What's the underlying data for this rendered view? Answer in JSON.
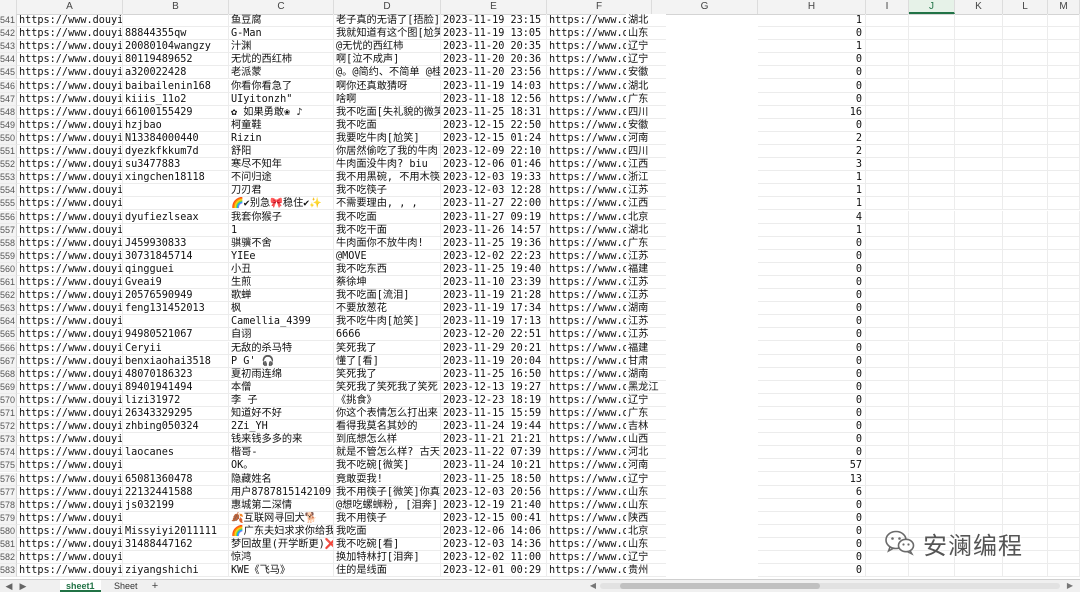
{
  "columns": [
    "",
    "A",
    "B",
    "C",
    "D",
    "E",
    "F",
    "G",
    "H",
    "I",
    "J",
    "K",
    "L",
    "M"
  ],
  "selected_column": "J",
  "rows": [
    [
      "541",
      "https://www.douyin.cc",
      "",
      "鱼豆腐",
      "老子真的无语了[捂脸]",
      "2023-11-19 23:15",
      "https://www.douyin.cc",
      "湖北",
      "1"
    ],
    [
      "542",
      "https://www.douyin.cc",
      "88844355qw",
      "G-Man",
      "我就知道有这个图[尬笑]",
      "2023-11-19 13:05",
      "https://www.douyin.cc",
      "山东",
      "0"
    ],
    [
      "543",
      "https://www.douyin.cc",
      "20080104wangzy",
      "汁渊",
      "@无忧的西红柿",
      "2023-11-20 20:35",
      "https://www.douyin.cc",
      "辽宁",
      "1"
    ],
    [
      "544",
      "https://www.douyin.cc",
      "80119489652",
      "无忧的西红柿",
      "啊[泣不成声]",
      "2023-11-20 20:36",
      "https://www.douyin.cc",
      "辽宁",
      "0"
    ],
    [
      "545",
      "https://www.douyin.cc",
      "a320022428",
      "老派蒙",
      "@。@简约、不简单 @桂@",
      "2023-11-20 23:56",
      "https://www.douyin.cc",
      "安徽",
      "0"
    ],
    [
      "546",
      "https://www.douyin.cc",
      "baibailenin168",
      "你看你看急了",
      "啊你还真敢猜呀",
      "2023-11-19 14:03",
      "https://www.douyin.cc",
      "湖北",
      "0"
    ],
    [
      "547",
      "https://www.douyin.cc",
      "kiiis_11o2",
      "UIyitonzh\"",
      "啥啊",
      "2023-11-18 12:56",
      "https://www.douyin.cc",
      "广东",
      "0"
    ],
    [
      "548",
      "https://www.douyin.cc",
      "66100155429",
      "✿ 如果勇敢❀ ♪",
      "我不吃面[失礼貌的微笑]",
      "2023-11-25 18:31",
      "https://www.douyin.cc",
      "四川",
      "16"
    ],
    [
      "549",
      "https://www.douyin.cc",
      "hzjbao",
      "柯童鞋",
      "我不吃面",
      "2023-12-15 22:50",
      "https://www.douyin.cc",
      "安徽",
      "0"
    ],
    [
      "550",
      "https://www.douyin.cc",
      "N13384000440",
      "Rizin",
      "我要吃牛肉[尬笑]",
      "2023-12-15 01:24",
      "https://www.douyin.cc",
      "河南",
      "2"
    ],
    [
      "551",
      "https://www.douyin.cc",
      "dyezkfkkum7d",
      "舒阳",
      "你居然偷吃了我的牛肉",
      "2023-12-09 22:10",
      "https://www.douyin.cc",
      "四川",
      "2"
    ],
    [
      "552",
      "https://www.douyin.cc",
      "su3477883",
      "寒尽不知年",
      "牛肉面没牛肉? biu",
      "2023-12-06 01:46",
      "https://www.douyin.cc",
      "江西",
      "3"
    ],
    [
      "553",
      "https://www.douyin.cc",
      "xingchen18118",
      "不问归途",
      "我不用黑碗, 不用木筷",
      "2023-12-03 19:33",
      "https://www.douyin.cc",
      "浙江",
      "1"
    ],
    [
      "554",
      "https://www.douyin.cc",
      "",
      "刀刃君",
      "我不吃筷子",
      "2023-12-03 12:28",
      "https://www.douyin.cc",
      "江苏",
      "1"
    ],
    [
      "555",
      "https://www.douyin.cc",
      "",
      "🌈✔别急🎀稳住✔✨",
      "不需要理由, , ,",
      "2023-11-27 22:00",
      "https://www.douyin.cc",
      "江西",
      "1"
    ],
    [
      "556",
      "https://www.douyin.cc",
      "dyufiezlseax",
      "我套你猴子",
      "我不吃面",
      "2023-11-27 09:19",
      "https://www.douyin.cc",
      "北京",
      "4"
    ],
    [
      "557",
      "https://www.douyin.cc",
      "",
      "1",
      "我不吃干面",
      "2023-11-26 14:57",
      "https://www.douyin.cc",
      "湖北",
      "1"
    ],
    [
      "558",
      "https://www.douyin.cc",
      "J459930833",
      "骐骥不舍",
      "牛肉面你不放牛肉!",
      "2023-11-25 19:36",
      "https://www.douyin.cc",
      "广东",
      "0"
    ],
    [
      "559",
      "https://www.douyin.cc",
      "30731845714",
      "YIEe",
      "@MOVE",
      "2023-12-02 22:23",
      "https://www.douyin.cc",
      "江苏",
      "0"
    ],
    [
      "560",
      "https://www.douyin.cc",
      "qingguei",
      "小丑",
      "我不吃东西",
      "2023-11-25 19:40",
      "https://www.douyin.cc",
      "福建",
      "0"
    ],
    [
      "561",
      "https://www.douyin.cc",
      "Gveai9",
      "生煎",
      "蔡徐坤",
      "2023-11-10 23:39",
      "https://www.douyin.cc",
      "江苏",
      "0"
    ],
    [
      "562",
      "https://www.douyin.cc",
      "20576590949",
      "歌蝉",
      "我不吃面[流泪]",
      "2023-11-19 21:28",
      "https://www.douyin.cc",
      "江苏",
      "0"
    ],
    [
      "563",
      "https://www.douyin.cc",
      "feng131452013",
      "枫",
      "不要放葱花",
      "2023-11-19 17:34",
      "https://www.douyin.cc",
      "湖南",
      "0"
    ],
    [
      "564",
      "https://www.douyin.cc",
      "",
      "Camellia_4399",
      "我不吃牛肉[尬笑]",
      "2023-11-19 17:13",
      "https://www.douyin.cc",
      "江苏",
      "0"
    ],
    [
      "565",
      "https://www.douyin.cc",
      "94980521067",
      "自诩",
      "6666",
      "2023-12-20 22:51",
      "https://www.douyin.cc",
      "江苏",
      "0"
    ],
    [
      "566",
      "https://www.douyin.cc",
      "Ceryii",
      "无敌的杀马特",
      "笑死我了",
      "2023-11-29 20:21",
      "https://www.douyin.cc",
      "福建",
      "0"
    ],
    [
      "567",
      "https://www.douyin.cc",
      "benxiaohai3518",
      "P G' 🎧",
      "懂了[看]",
      "2023-11-19 20:04",
      "https://www.douyin.cc",
      "甘肃",
      "0"
    ],
    [
      "568",
      "https://www.douyin.cc",
      "48070186323",
      "夏初雨连绵",
      "笑死我了",
      "2023-11-25 16:50",
      "https://www.douyin.cc",
      "湖南",
      "0"
    ],
    [
      "569",
      "https://www.douyin.cc",
      "89401941494",
      "本僧",
      "笑死我了笑死我了笑死",
      "2023-12-13 19:27",
      "https://www.douyin.cc",
      "黑龙江",
      "0"
    ],
    [
      "570",
      "https://www.douyin.cc",
      "lizi31972",
      "李 子",
      "《挑食》",
      "2023-12-23 18:19",
      "https://www.douyin.cc",
      "辽宁",
      "0"
    ],
    [
      "571",
      "https://www.douyin.cc",
      "26343329295",
      "知道好不好",
      "你这个表情怎么打出来",
      "2023-11-15 15:59",
      "https://www.douyin.cc",
      "广东",
      "0"
    ],
    [
      "572",
      "https://www.douyin.cc",
      "zhbing050324",
      "2Zi_YH",
      "看得我莫名其妙的",
      "2023-11-24 19:44",
      "https://www.douyin.cc",
      "吉林",
      "0"
    ],
    [
      "573",
      "https://www.douyin.cc",
      "",
      "钱来钱多多的来",
      "到底想怎么样",
      "2023-11-21 21:21",
      "https://www.douyin.cc",
      "山西",
      "0"
    ],
    [
      "574",
      "https://www.douyin.cc",
      "laocanes",
      "楷哥-",
      "就是不管怎么样? 古天",
      "2023-11-22 07:39",
      "https://www.douyin.cc",
      "河北",
      "0"
    ],
    [
      "575",
      "https://www.douyin.cc",
      "",
      "OK。",
      "我不吃碗[微笑]",
      "2023-11-24 10:21",
      "https://www.douyin.cc",
      "河南",
      "57"
    ],
    [
      "576",
      "https://www.douyin.cc",
      "65081360478",
      "隐藏姓名",
      "竟敢耍我!",
      "2023-11-25 18:50",
      "https://www.douyin.cc",
      "辽宁",
      "13"
    ],
    [
      "577",
      "https://www.douyin.cc",
      "22132441588",
      "用户8787815142109",
      "我不用筷子[微笑]你真",
      "2023-12-03 20:56",
      "https://www.douyin.cc",
      "山东",
      "6"
    ],
    [
      "578",
      "https://www.douyin.cc",
      "js032199",
      "惠城第二深情",
      "@想吃螺蛳粉, [泪奔]",
      "2023-12-19 21:40",
      "https://www.douyin.cc",
      "山东",
      "0"
    ],
    [
      "579",
      "https://www.douyin.cc",
      "",
      "🍂互联网寻回犬🐕",
      "我不用筷子",
      "2023-12-15 00:41",
      "https://www.douyin.cc",
      "陕西",
      "0"
    ],
    [
      "580",
      "https://www.douyin.cc",
      "Missyiyi2011111",
      "🌈广东夫妇求求你给我",
      "我吃面",
      "2023-12-06 14:06",
      "https://www.douyin.cc",
      "北京",
      "0"
    ],
    [
      "581",
      "https://www.douyin.cc",
      "31488447162",
      "梦回故里(开学断更)❌",
      "我不吃碗[看]",
      "2023-12-03 14:36",
      "https://www.douyin.cc",
      "山东",
      "0"
    ],
    [
      "582",
      "https://www.douyin.cc",
      "",
      "惊鸿",
      "换加特林打[泪奔]",
      "2023-12-02 11:00",
      "https://www.douyin.cc",
      "辽宁",
      "0"
    ],
    [
      "583",
      "https://www.douyin.cc",
      "ziyangshichi",
      "KWE《飞马》",
      "住的是线面",
      "2023-12-01 00:29",
      "https://www.douyin.cc",
      "贵州",
      "0"
    ]
  ],
  "watermark": {
    "text": "安澜编程",
    "icon": "wechat-icon"
  },
  "tabs": [
    "sheet1",
    "Sheet"
  ],
  "active_tab": "sheet1",
  "colors": {
    "accent": "#217346",
    "grid": "#ececec",
    "header_bg": "#f3f3f3"
  }
}
